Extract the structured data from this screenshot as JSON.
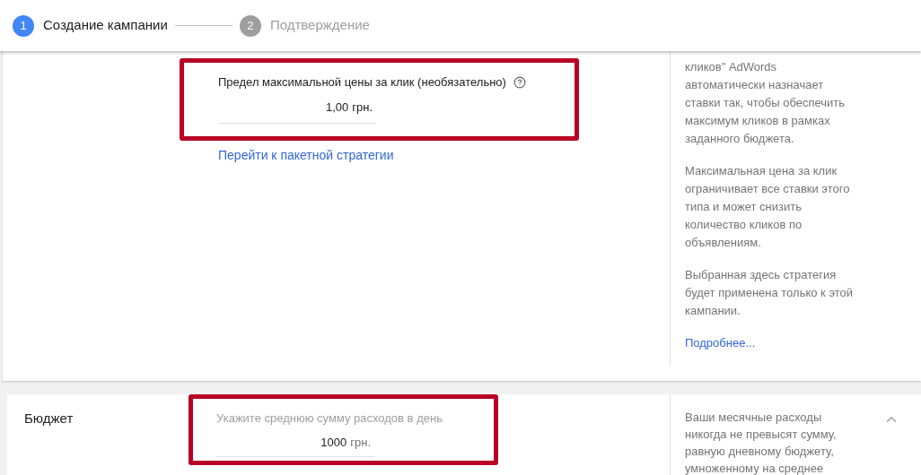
{
  "stepper": {
    "steps": [
      {
        "number": "1",
        "label": "Создание кампании",
        "selected": true
      },
      {
        "number": "2",
        "label": "Подтверждение",
        "selected": false
      }
    ]
  },
  "strategy_section": {
    "bid_limit": {
      "label": "Предел максимальной цены за клик (необязательно)",
      "value": "1,00",
      "suffix": "грн."
    },
    "link": "Перейти к пакетной стратегии",
    "help": [
      "кликов\" AdWords\nавтоматически назначает\nставки так, чтобы обеспечить\nмаксимум кликов в рамках\nзаданного бюджета.",
      "Максимальная цена за клик\nограничивает все ставки этого\nтипа и может снизить\nколичество кликов по\nобъявлениям.",
      "Выбранная здесь стратегия\nбудет применена только к этой\nкампании."
    ],
    "more_link": "Подробнее..."
  },
  "budget_section": {
    "title": "Бюджет",
    "field": {
      "label": "Укажите среднюю сумму расходов в день",
      "value": "1000",
      "suffix": "грн."
    },
    "help": "Ваши месячные расходы\nникогда не превысят сумму,\nравную дневному бюджету,\nумноженному на среднее",
    "expanded": true
  }
}
